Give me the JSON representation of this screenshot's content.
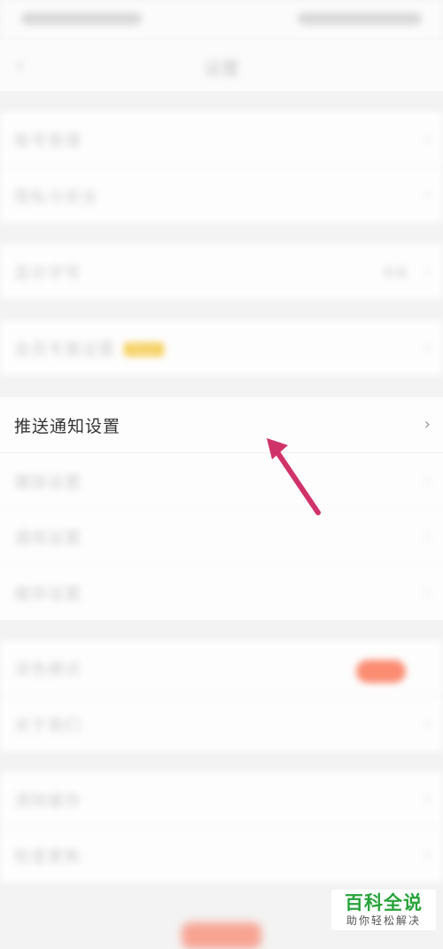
{
  "status_bar": {
    "time": "",
    "indicators": ""
  },
  "nav": {
    "back_icon": "chevron-left-icon",
    "title": "设置"
  },
  "groups": [
    {
      "items": [
        {
          "label": "账号管理"
        },
        {
          "label": "隐私与安全"
        }
      ]
    },
    {
      "items": [
        {
          "label": "显示字号",
          "value": "标准"
        }
      ]
    },
    {
      "items": [
        {
          "label": "会员专属设置",
          "badge": "New"
        }
      ]
    },
    {
      "items": [
        {
          "label": "推送通知设置",
          "highlight": true
        },
        {
          "label": "播放设置"
        },
        {
          "label": "通用设置"
        },
        {
          "label": "缓存设置"
        }
      ]
    },
    {
      "items": [
        {
          "label": "深色模式",
          "toggle": true
        },
        {
          "label": "关于我们"
        }
      ]
    },
    {
      "items": [
        {
          "label": "清除缓存"
        },
        {
          "label": "检查更新"
        }
      ]
    }
  ],
  "annotation": {
    "arrow_color": "#d0336a"
  },
  "watermark": {
    "main": "百科全说",
    "sub": "助你轻松解决"
  },
  "colors": {
    "accent": "#fb8c72",
    "badge": "#f5cf5a",
    "watermark_green": "#27a33a"
  }
}
